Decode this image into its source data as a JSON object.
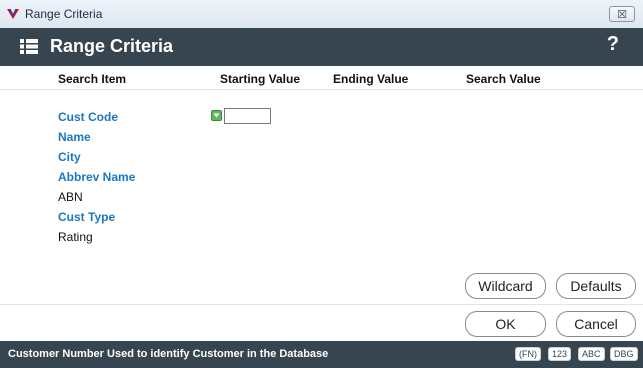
{
  "window": {
    "title": "Range Criteria",
    "close_glyph": "☒"
  },
  "header": {
    "title": "Range Criteria",
    "help_glyph": "?"
  },
  "columns": [
    "Search Item",
    "Starting Value",
    "Ending Value",
    "Search Value"
  ],
  "fields": [
    "Cust Code",
    "Name",
    "City",
    "Abbrev Name",
    "ABN",
    "Cust Type",
    "Rating"
  ],
  "starting_value_input": {
    "value": ""
  },
  "buttons": {
    "wildcard": "Wildcard",
    "defaults": "Defaults",
    "ok": "OK",
    "cancel": "Cancel"
  },
  "status": {
    "text": "Customer Number  Used to identify Customer in the Database",
    "badges": [
      "(FN)",
      "123",
      "ABC",
      "DBG"
    ]
  },
  "colors": {
    "header_bg": "#36454f",
    "link": "#1a78c2",
    "dropdown_green": "#5cb85c"
  }
}
